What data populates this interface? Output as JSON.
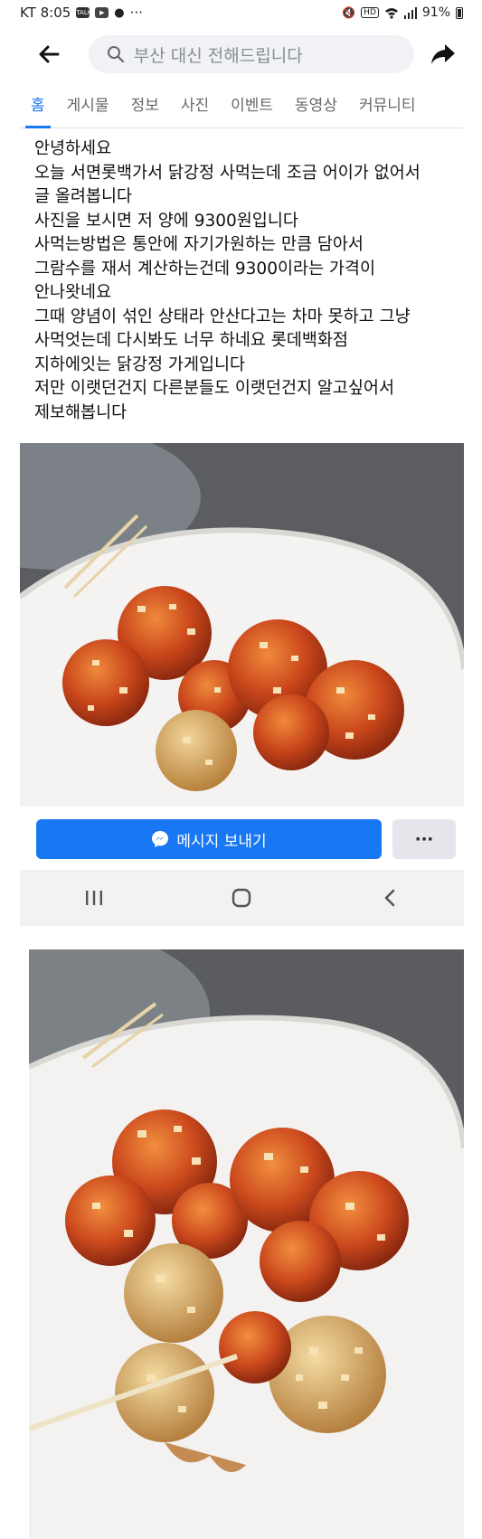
{
  "status_bar": {
    "carrier_time": "KT 8:05",
    "icons": [
      "talk-icon",
      "youtube-icon",
      "app-icon",
      "more-dots-icon"
    ],
    "status_icons": [
      "mute-icon",
      "hd-icon",
      "wifi-icon",
      "signal-icon"
    ],
    "battery": "91%",
    "more": "···"
  },
  "header": {
    "search_text": "부산 대신 전해드립니다",
    "back_icon": "arrow-left-icon",
    "share_icon": "share-arrow-icon"
  },
  "tabs": [
    "홈",
    "게시물",
    "정보",
    "사진",
    "이벤트",
    "동영상",
    "커뮤니티"
  ],
  "post": {
    "lines": [
      "안녕하세요",
      "오늘 서면롯백가서 닭강정 사먹는데 조금 어이가 없어서",
      "글 올려봅니다",
      "사진을 보시면 저 양에 9300원입니다",
      "사먹는방법은 통안에 자기가원하는 만큼 담아서",
      "그람수를 재서 계산하는건데 9300이라는 가격이",
      "안나왓네요",
      "그때 양념이 섞인 상태라 안산다고는 차마 못하고 그냥",
      "사먹엇는데 다시봐도 너무 하네요 롯데백화점",
      "지하에잇는 닭강정 가게입니다",
      "저만 이랫던건지 다른분들도 이랫던건지 알고싶어서",
      "제보해봅니다"
    ]
  },
  "actions": {
    "message_label": "메시지 보내기",
    "more_label": "···"
  },
  "colors": {
    "accent": "#1877f2",
    "background": "#ffffff",
    "nav_bar": "#f2f2f4"
  }
}
